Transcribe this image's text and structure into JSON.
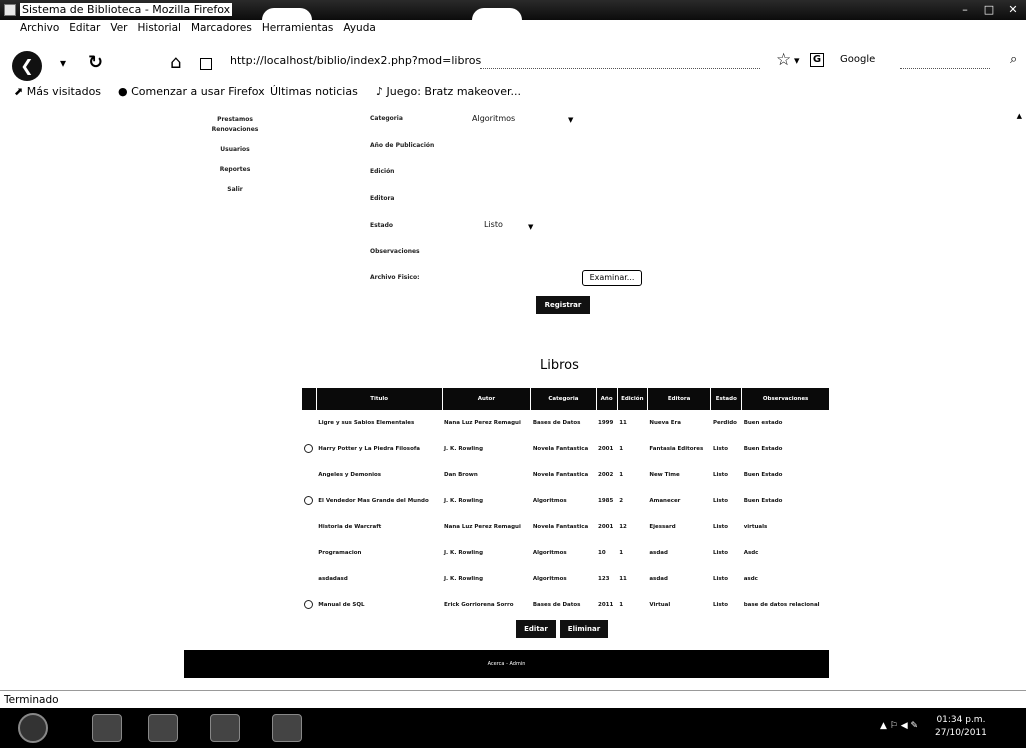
{
  "window": {
    "title": "Sistema de Biblioteca - Mozilla Firefox"
  },
  "menubar": [
    "Archivo",
    "Editar",
    "Ver",
    "Historial",
    "Marcadores",
    "Herramientas",
    "Ayuda"
  ],
  "navbar": {
    "url": "http://localhost/biblio/index2.php?mod=libros",
    "search_engine": "Google"
  },
  "bookmarks": [
    "Más visitados",
    "Comenzar a usar Firefox",
    "Últimas noticias",
    "Juego: Bratz makeover..."
  ],
  "side_menu": [
    "Prestamos",
    "Renovaciones",
    "Usuarios",
    "Reportes",
    "Salir"
  ],
  "form": {
    "categoria_label": "Categoria",
    "categoria_value": "Algoritmos",
    "anio_label": "Año de Publicación",
    "edicion_label": "Edición",
    "editora_label": "Editora",
    "estado_label": "Estado",
    "estado_value": "Listo",
    "observaciones_label": "Observaciones",
    "archivo_label": "Archivo Fisico:",
    "file_button": "Examinar...",
    "submit_button": "Registrar"
  },
  "libros": {
    "title": "Libros",
    "headers": [
      "",
      "Titulo",
      "Autor",
      "Categoria",
      "Año",
      "Edición",
      "Editora",
      "Estado",
      "Observaciones"
    ],
    "rows": [
      [
        "",
        "Ligre y sus Sabios Elementales",
        "Nana Luz Perez Remagui",
        "Bases de Datos",
        "1999",
        "11",
        "Nueva Era",
        "Perdido",
        "Buen estado"
      ],
      [
        "radio",
        "Harry Potter y La Piedra Filosofa",
        "J. K. Rowling",
        "Novela Fantastica",
        "2001",
        "1",
        "Fantasia Editores",
        "Listo",
        "Buen Estado"
      ],
      [
        "",
        "Angeles y Demonios",
        "Dan Brown",
        "Novela Fantastica",
        "2002",
        "1",
        "New Time",
        "Listo",
        "Buen Estado"
      ],
      [
        "radio",
        "El Vendedor Mas Grande del Mundo",
        "J. K. Rowling",
        "Algoritmos",
        "1985",
        "2",
        "Amanecer",
        "Listo",
        "Buen Estado"
      ],
      [
        "",
        "Historia de Warcraft",
        "Nana Luz Perez Remagui",
        "Novela Fantastica",
        "2001",
        "12",
        "Ejessard",
        "Listo",
        "virtuals"
      ],
      [
        "",
        "Programacion",
        "J. K. Rowling",
        "Algoritmos",
        "10",
        "1",
        "asdad",
        "Listo",
        "Asdc"
      ],
      [
        "",
        "asdadasd",
        "J. K. Rowling",
        "Algoritmos",
        "123",
        "11",
        "asdad",
        "Listo",
        "asdc"
      ],
      [
        "radio",
        "Manual de SQL",
        "Erick Gorriorena Sorro",
        "Bases de Datos",
        "2011",
        "1",
        "Virtual",
        "Listo",
        "base de datos relacional"
      ]
    ],
    "edit_button": "Editar",
    "delete_button": "Eliminar"
  },
  "footer": {
    "text": "Acerca - Admin"
  },
  "statusbar": {
    "text": "Terminado"
  },
  "taskbar": {
    "time": "01:34 p.m.",
    "date": "27/10/2011"
  }
}
